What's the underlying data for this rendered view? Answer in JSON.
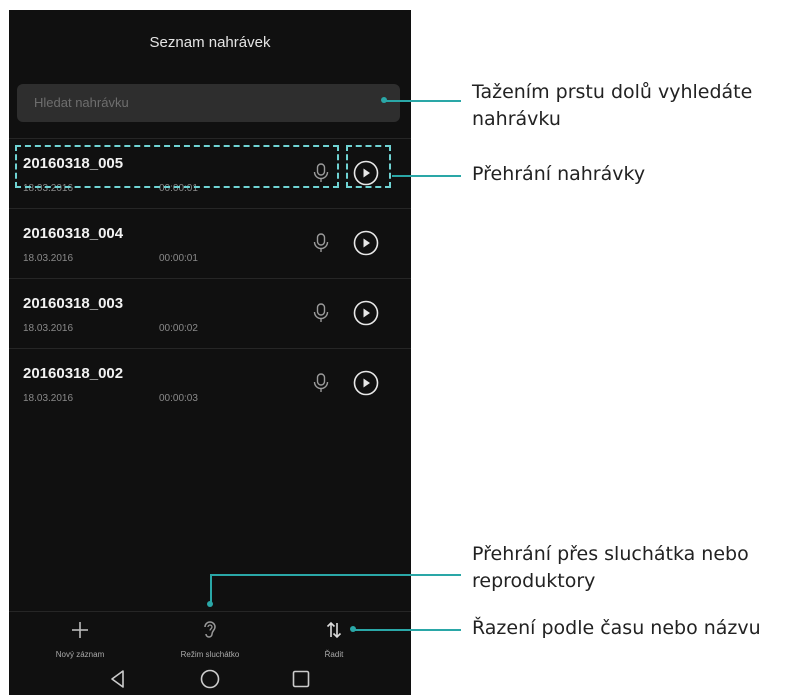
{
  "screen": {
    "title": "Seznam nahrávek",
    "search_placeholder": "Hledat nahrávku"
  },
  "recordings": [
    {
      "name": "20160318_005",
      "date": "18.03.2016",
      "duration": "00:00:01"
    },
    {
      "name": "20160318_004",
      "date": "18.03.2016",
      "duration": "00:00:01"
    },
    {
      "name": "20160318_003",
      "date": "18.03.2016",
      "duration": "00:00:02"
    },
    {
      "name": "20160318_002",
      "date": "18.03.2016",
      "duration": "00:00:03"
    }
  ],
  "toolbar": {
    "new_label": "Nový záznam",
    "earpiece_label": "Režim sluchátko",
    "sort_label": "Řadit"
  },
  "callouts": {
    "search": [
      "Tažením prstu dolů vyhledáte",
      "nahrávku"
    ],
    "play": "Přehrání nahrávky",
    "earpiece": [
      "Přehrání přes sluchátka nebo",
      "reproduktory"
    ],
    "sort": "Řazení podle času nebo názvu"
  },
  "colors": {
    "accent": "#2aa7a7",
    "screen_bg": "#101010",
    "search_bg": "#2e2e2e"
  },
  "icons": {
    "record_mode": "microphone-icon",
    "play": "play-icon",
    "new": "plus-icon",
    "earpiece": "ear-icon",
    "sort": "sort-icon",
    "back": "back-triangle-icon",
    "home": "home-circle-icon",
    "recents": "recents-square-icon"
  }
}
